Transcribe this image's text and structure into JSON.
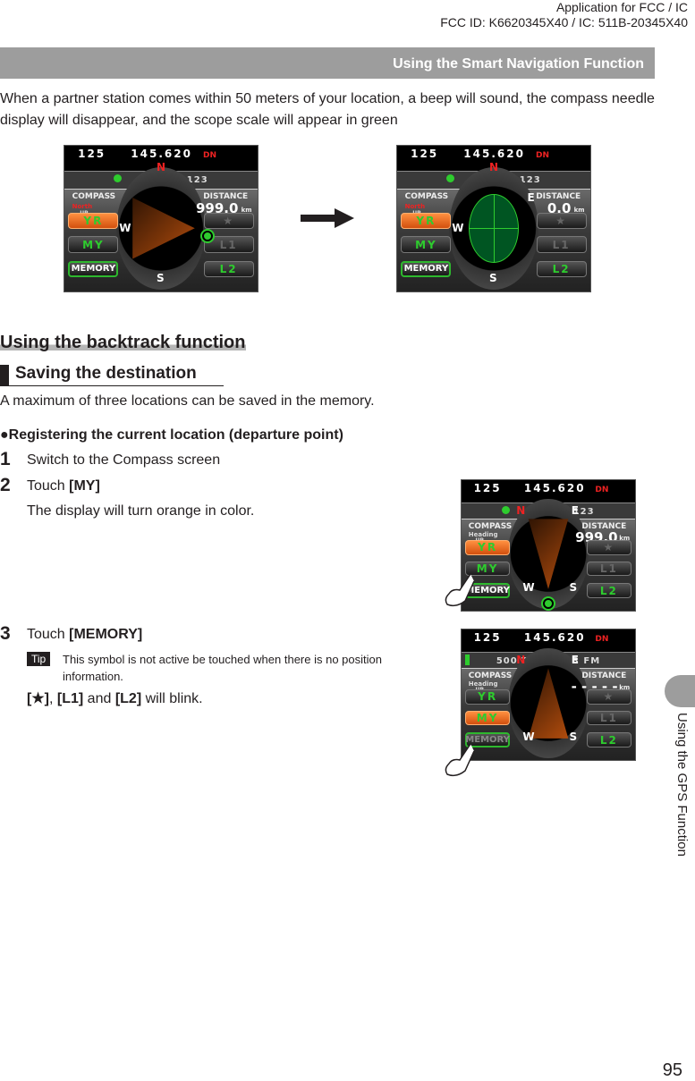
{
  "header": {
    "fcc_line1": "Application for FCC / IC",
    "fcc_line2": "FCC ID: K6620345X40 / IC: 511B-20345X40",
    "section_bar": "Using the Smart Navigation Function"
  },
  "intro": "When a partner station comes within 50 meters of your location, a beep will sound, the compass needle display will disappear, and the scope scale will appear in green",
  "backtrack": {
    "title": "Using the backtrack function",
    "subtitle": "Saving the destination",
    "desc": "A maximum of three locations can be saved in the memory.",
    "bullet": "Registering the current location (departure point)",
    "steps": [
      {
        "num": "1",
        "text": "Switch to the Compass screen"
      },
      {
        "num": "2",
        "text": "Touch ",
        "bold": "[MY]",
        "sub": "The display will turn orange in color."
      },
      {
        "num": "3",
        "text": "Touch ",
        "bold": "[MEMORY]",
        "tip_label": "Tip",
        "tip": "This symbol is not active be touched when there is no position information.",
        "blink_a": "[★]",
        "blink_b": ", ",
        "blink_c": "[L1]",
        "blink_d": " and ",
        "blink_e": "[L2]",
        "blink_f": " will blink."
      }
    ]
  },
  "screens": [
    {
      "ch": "125",
      "freq": "145.620",
      "row2": "JA1ZRL-123",
      "dot": "green",
      "mode": "North",
      "mode2": "UP",
      "compass": "COMPASS",
      "distance_label": "DISTANCE",
      "distance": "999.0",
      "unit": "km",
      "needle": "right",
      "yr": "YR",
      "my": "MY",
      "memory": "MEMORY",
      "star": "★",
      "l1": "L1",
      "l2": "L2",
      "orange": "yr",
      "cardinals": {
        "N": "N",
        "W": "W",
        "S": "S"
      }
    },
    {
      "ch": "125",
      "freq": "145.620",
      "row2": "JA1ZRL-123",
      "dot": "green",
      "mode": "North",
      "mode2": "UP",
      "compass": "COMPASS",
      "distance_label": "DISTANCE",
      "distance": "0.0",
      "unit": "km",
      "needle": "scope",
      "yr": "YR",
      "my": "MY",
      "memory": "MEMORY",
      "star": "★",
      "l1": "L1",
      "l2": "L2",
      "orange": "yr",
      "cardinals": {
        "N": "N",
        "W": "W",
        "S": "S",
        "E": "E"
      }
    },
    {
      "ch": "125",
      "freq": "145.620",
      "row2": "JA1ZRL-123",
      "dot": "green",
      "mode": "Heading",
      "mode2": "UP",
      "compass": "COMPASS",
      "distance_label": "DISTANCE",
      "distance": "999.0",
      "unit": "km",
      "needle": "down",
      "yr": "YR",
      "my": "MY",
      "memory": "MEMORY",
      "star": "★",
      "l1": "L1",
      "l2": "L2",
      "orange": "yr",
      "cardinals": {
        "N": "N",
        "E": "E",
        "W": "W",
        "S": "S"
      }
    },
    {
      "ch": "125",
      "freq": "145.620",
      "row2": "500   TOKYO-23 FM",
      "dot": "bar",
      "mode": "Heading",
      "mode2": "UP",
      "compass": "COMPASS",
      "distance_label": "DISTANCE",
      "distance": "- - - - -",
      "unit": "km",
      "needle": "up",
      "yr": "YR",
      "my": "MY",
      "memory": "MEMORY",
      "star": "★",
      "l1": "L1",
      "l2": "L2",
      "orange": "my",
      "cardinals": {
        "N": "N",
        "E": "E",
        "W": "W",
        "S": "S"
      }
    }
  ],
  "colors": {
    "section_bar": "#9d9d9d",
    "orange_button": "#e8641e",
    "green_text": "#2ecc2e"
  },
  "sidebar": {
    "label": "Using the GPS Function"
  },
  "page_number": "95"
}
